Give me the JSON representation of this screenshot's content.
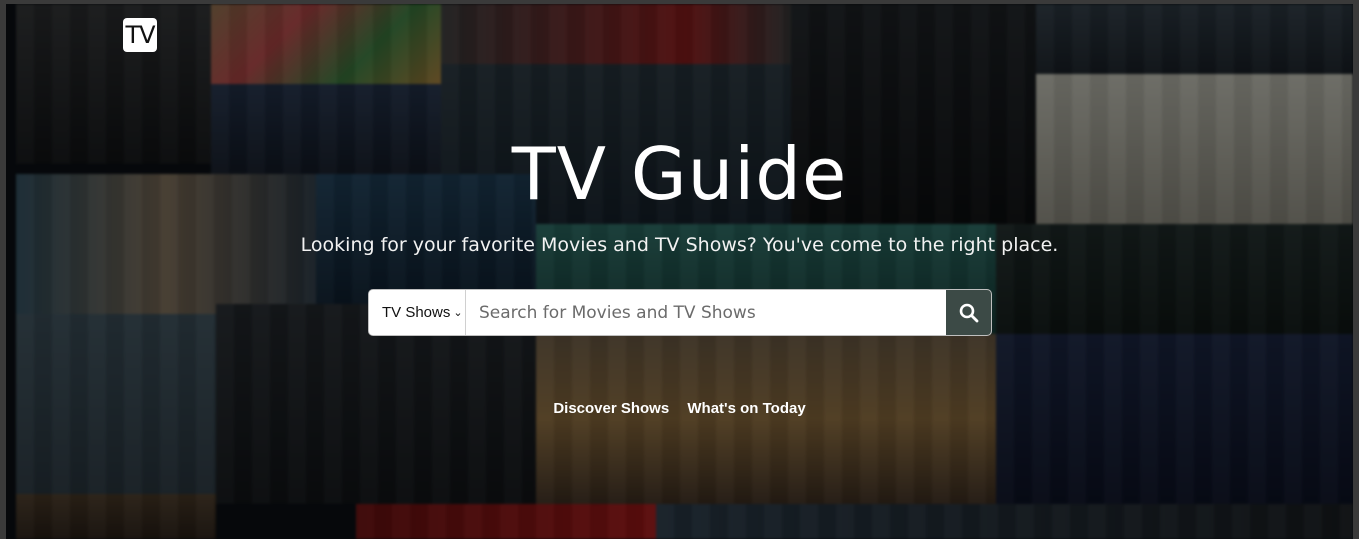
{
  "logo": {
    "text": "TV"
  },
  "hero": {
    "title": "TV Guide",
    "subtitle": "Looking for your favorite Movies and TV Shows? You've come to the right place."
  },
  "search": {
    "type_selected": "TV Shows",
    "placeholder": "Search for Movies and TV Shows",
    "button_icon": "search-icon"
  },
  "nav": {
    "discover": "Discover Shows",
    "today": "What's on Today"
  },
  "colors": {
    "search_button": "#3c4a46",
    "overlay": "rgba(0,0,0,0.42)",
    "text": "#ffffff"
  }
}
